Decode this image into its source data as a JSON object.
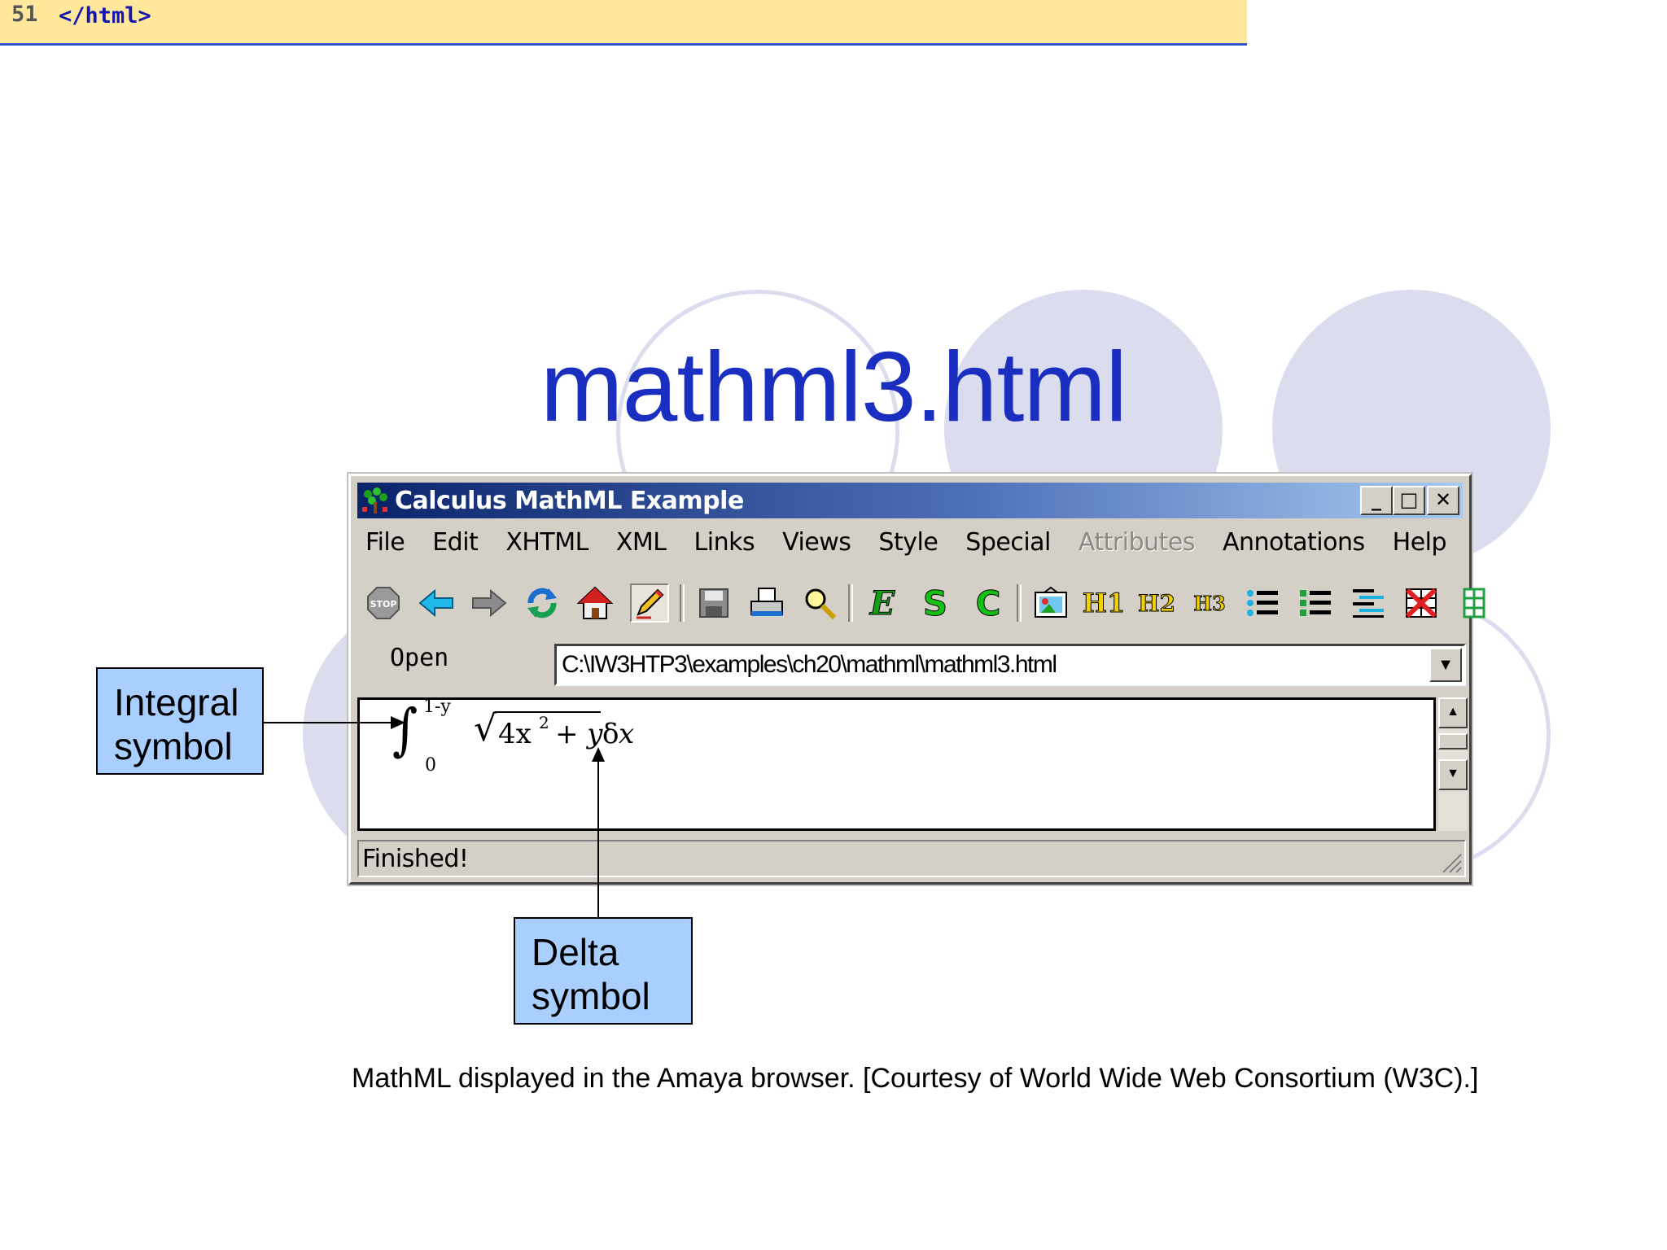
{
  "code_strip": {
    "line_number": "51",
    "code": "</html>"
  },
  "slide": {
    "title": "mathml3.html",
    "caption": "MathML displayed in the Amaya browser. [Courtesy of World Wide Web Consortium (W3C).]"
  },
  "window": {
    "title": "Calculus MathML Example",
    "controls": {
      "minimize": "_",
      "maximize": "□",
      "close": "✕"
    },
    "menu": [
      {
        "label": "File"
      },
      {
        "label": "Edit"
      },
      {
        "label": "XHTML"
      },
      {
        "label": "XML"
      },
      {
        "label": "Links"
      },
      {
        "label": "Views"
      },
      {
        "label": "Style"
      },
      {
        "label": "Special"
      },
      {
        "label": "Attributes"
      },
      {
        "label": "Annotations"
      },
      {
        "label": "Help"
      }
    ],
    "toolbar_icons": [
      "stop-icon",
      "back-arrow-icon",
      "forward-arrow-icon",
      "reload-icon",
      "home-icon",
      "edit-pencil-icon",
      "save-icon",
      "print-icon",
      "find-icon",
      "e-icon",
      "s-icon",
      "c-icon",
      "image-icon",
      "h1-icon",
      "h2-icon",
      "h3-icon",
      "bullet-list-icon",
      "numbered-list-icon",
      "definition-list-icon",
      "table-delete-icon",
      "table-icon"
    ],
    "toolbar_text": {
      "stop": "STOP",
      "e": "E",
      "s": "S",
      "c": "C",
      "h1": "H1",
      "h2": "H2",
      "h3": "H3"
    },
    "address": {
      "label": "Open",
      "value": "C:\\IW3HTP3\\examples\\ch20\\mathml\\mathml3.html"
    },
    "status": "Finished!",
    "math": {
      "integral": "∫",
      "upper_limit": "1-y",
      "lower_limit": "0",
      "radical": "√",
      "radicand_base": "4x",
      "exponent": "2",
      "radicand_rest": "+ y",
      "delta": "δ",
      "variable": "x"
    }
  },
  "callouts": {
    "integral": [
      "Integral",
      "symbol"
    ],
    "delta": [
      "Delta",
      "symbol"
    ]
  },
  "colors": {
    "title": "#1a2fc0",
    "callout_fill": "#a8cfff",
    "code_strip": "#ffe89b",
    "circles": "#dcdcef",
    "titlebar_start": "#0a246a",
    "titlebar_end": "#a6caf0"
  }
}
